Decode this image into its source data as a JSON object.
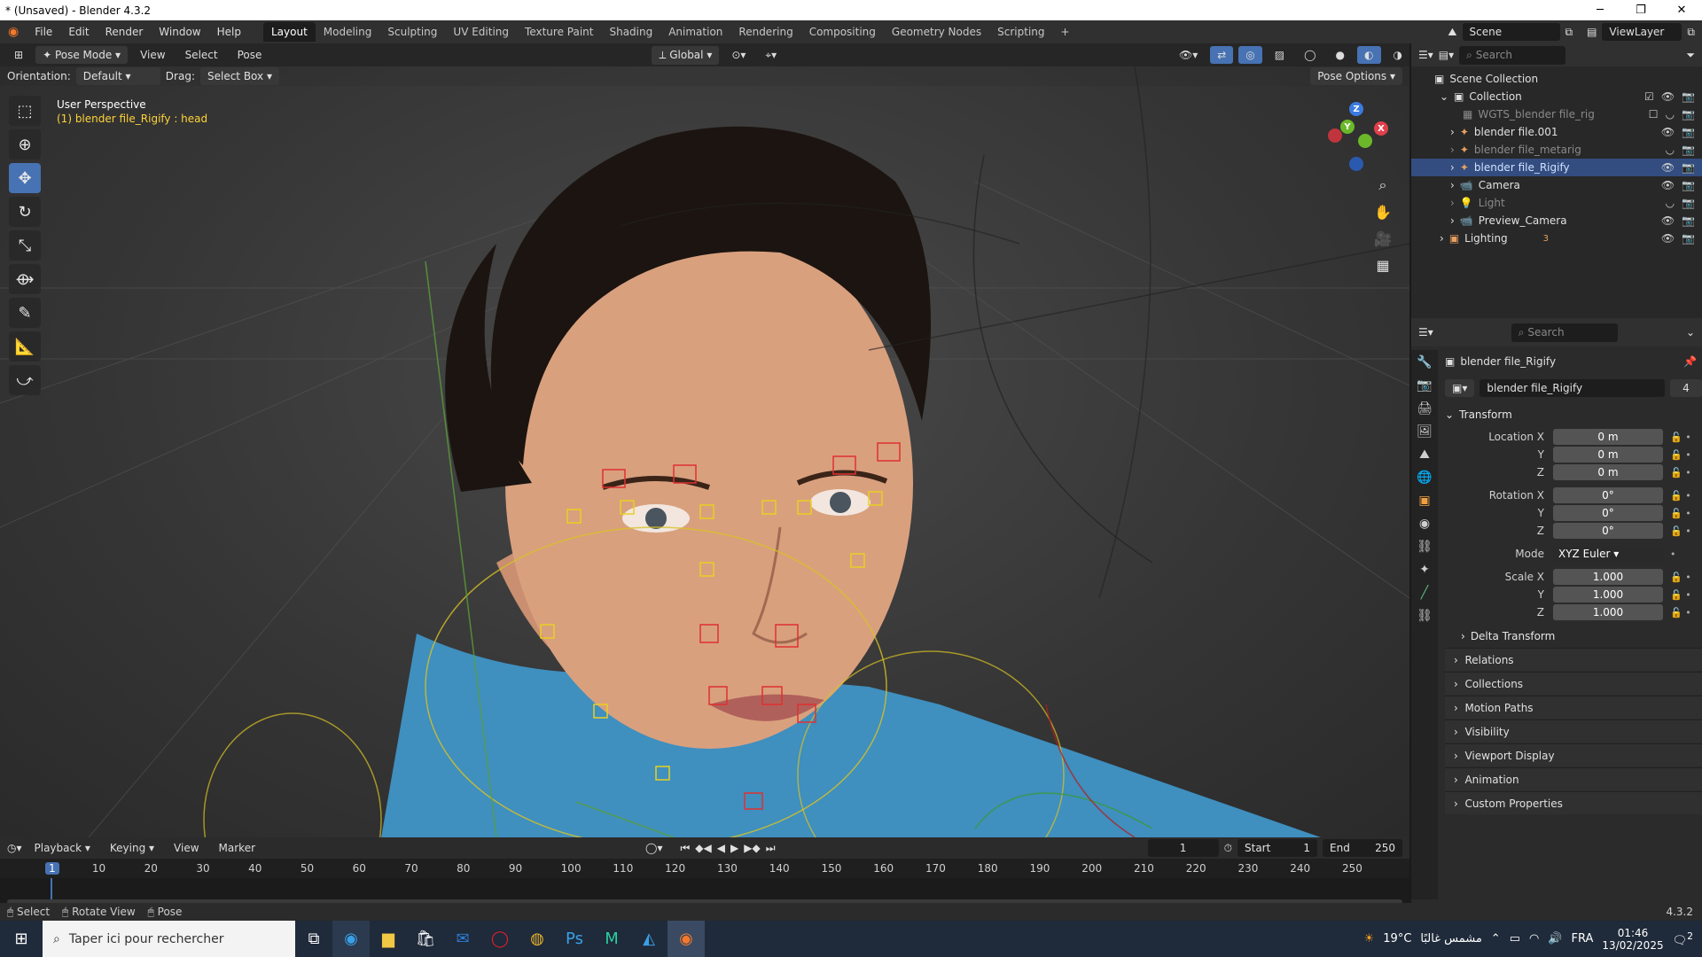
{
  "window": {
    "title": "* (Unsaved) - Blender 4.3.2"
  },
  "menu": {
    "items": [
      "File",
      "Edit",
      "Render",
      "Window",
      "Help"
    ]
  },
  "workspaces": [
    "Layout",
    "Modeling",
    "Sculpting",
    "UV Editing",
    "Texture Paint",
    "Shading",
    "Animation",
    "Rendering",
    "Compositing",
    "Geometry Nodes",
    "Scripting"
  ],
  "workspace_active": "Layout",
  "scene": {
    "scene_label": "Scene",
    "viewlayer_label": "ViewLayer"
  },
  "viewport_header": {
    "mode": "Pose Mode",
    "menus": [
      "View",
      "Select",
      "Pose"
    ],
    "transform": "Global",
    "orientation_label": "Orientation:",
    "orientation_value": "Default",
    "drag_label": "Drag:",
    "drag_value": "Select Box",
    "pose_options": "Pose Options"
  },
  "viewport_info": {
    "line1": "User Perspective",
    "line2": "(1) blender file_Rigify : head"
  },
  "gizmo": {
    "x": "X",
    "y": "Y",
    "z": "Z"
  },
  "outliner": {
    "search_placeholder": "Search",
    "scene_collection": "Scene Collection",
    "collection": "Collection",
    "rows": [
      {
        "name": "WGTS_blender file_rig",
        "dim": true
      },
      {
        "name": "blender file.001",
        "dim": false
      },
      {
        "name": "blender file_metarig",
        "dim": true
      },
      {
        "name": "blender file_Rigify",
        "dim": false,
        "selected": true
      },
      {
        "name": "Camera",
        "dim": false
      },
      {
        "name": "Light",
        "dim": true
      },
      {
        "name": "Preview_Camera",
        "dim": false
      }
    ],
    "lighting": "Lighting",
    "lighting_count": "3"
  },
  "properties": {
    "search_placeholder": "Search",
    "object_name": "blender file_Rigify",
    "data_name": "blender file_Rigify",
    "data_users": "4",
    "transform_title": "Transform",
    "location": {
      "label_x": "Location X",
      "x": "0 m",
      "y": "0 m",
      "z": "0 m"
    },
    "rotation": {
      "label_x": "Rotation X",
      "x": "0°",
      "y": "0°",
      "z": "0°"
    },
    "axis_y": "Y",
    "axis_z": "Z",
    "mode_label": "Mode",
    "mode_value": "XYZ Euler",
    "scale": {
      "label_x": "Scale X",
      "x": "1.000",
      "y": "1.000",
      "z": "1.000"
    },
    "delta": "Delta Transform",
    "panels": [
      "Relations",
      "Collections",
      "Motion Paths",
      "Visibility",
      "Viewport Display",
      "Animation",
      "Custom Properties"
    ]
  },
  "timeline": {
    "menus": [
      "Playback",
      "Keying",
      "View",
      "Marker"
    ],
    "current_frame": "1",
    "start_label": "Start",
    "start": "1",
    "end_label": "End",
    "end": "250",
    "ticks": [
      "1",
      "10",
      "20",
      "30",
      "40",
      "50",
      "60",
      "70",
      "80",
      "90",
      "100",
      "110",
      "120",
      "130",
      "140",
      "150",
      "160",
      "170",
      "180",
      "190",
      "200",
      "210",
      "220",
      "230",
      "240",
      "250"
    ]
  },
  "statusbar": {
    "items": [
      "Select",
      "Rotate View",
      "Pose"
    ],
    "version": "4.3.2"
  },
  "taskbar": {
    "search_placeholder": "Taper ici pour rechercher",
    "weather": "19°C",
    "weather_text": "مشمس غالبًا",
    "lang": "FRA",
    "time": "01:46",
    "date": "13/02/2025",
    "notif_count": "2"
  }
}
